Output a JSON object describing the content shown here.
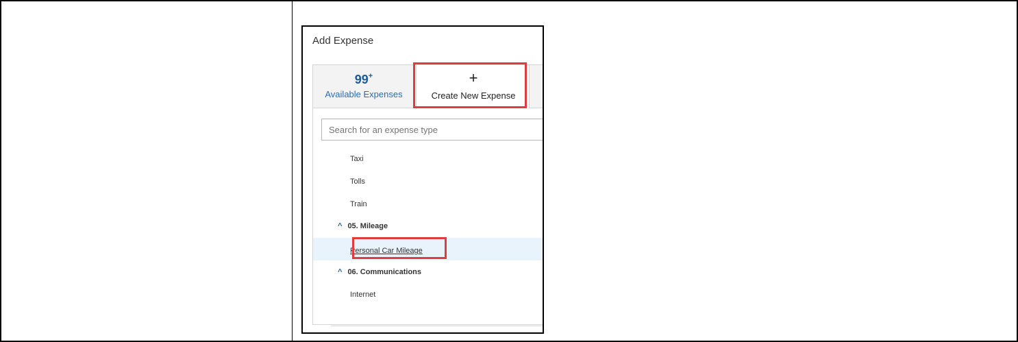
{
  "dialog": {
    "title": "Add Expense",
    "tabs": {
      "available": {
        "count": "99",
        "count_suffix": "+",
        "label": "Available Expenses"
      },
      "create": {
        "icon": "plus-icon",
        "symbol": "+",
        "label": "Create New Expense"
      }
    },
    "search": {
      "placeholder": "Search for an expense type"
    },
    "items": [
      {
        "label": "Taxi"
      },
      {
        "label": "Tolls"
      },
      {
        "label": "Train"
      }
    ],
    "groups": {
      "mileage": {
        "label": "05. Mileage",
        "chevron": "^"
      },
      "communications": {
        "label": "06. Communications",
        "chevron": "^"
      }
    },
    "selected_item": {
      "label": "Personal Car Mileage"
    },
    "internet_item": {
      "label": "Internet"
    }
  },
  "colors": {
    "highlight": "#e03c3c",
    "accent": "#1f5b94",
    "selected_row": "#e8f3fc"
  }
}
